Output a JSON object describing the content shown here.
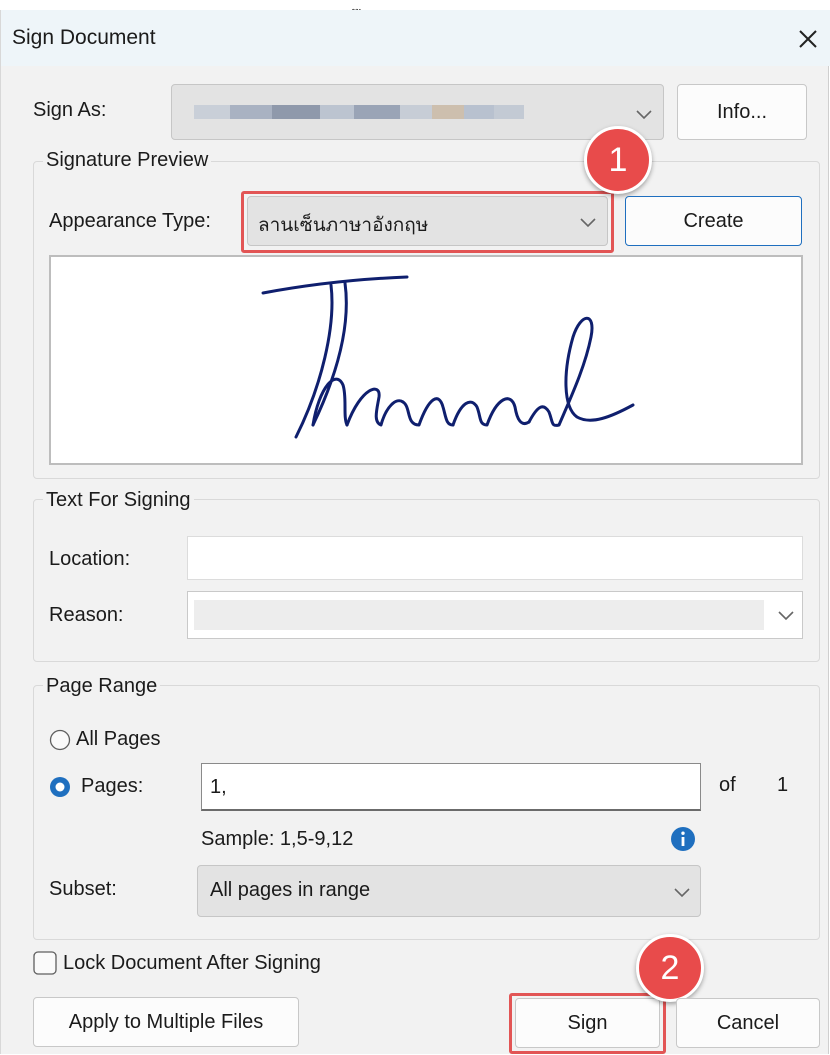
{
  "top_fragment": "ุ    ู",
  "dialog": {
    "title": "Sign Document",
    "close_icon": "close-icon"
  },
  "sign_as": {
    "label": "Sign As:",
    "value": "",
    "info_button": "Info..."
  },
  "signature_preview": {
    "legend": "Signature Preview",
    "appearance_label": "Appearance Type:",
    "appearance_value": "ลานเซ็นภาษาอังกฤษ",
    "create_button": "Create"
  },
  "text_for_signing": {
    "legend": "Text For Signing",
    "location_label": "Location:",
    "location_value": "",
    "reason_label": "Reason:",
    "reason_value": ""
  },
  "page_range": {
    "legend": "Page Range",
    "all_pages_label": "All Pages",
    "pages_label": "Pages:",
    "pages_value": "1,",
    "of_label": "of",
    "total_pages": "1",
    "sample_text": "Sample: 1,5-9,12",
    "info_icon": "info-icon",
    "subset_label": "Subset:",
    "subset_value": "All pages in range",
    "selected": "pages"
  },
  "lock_document": {
    "label": "Lock Document After Signing",
    "checked": false
  },
  "buttons": {
    "apply_multiple": "Apply to Multiple Files",
    "sign": "Sign",
    "cancel": "Cancel"
  },
  "annotations": {
    "step1": "1",
    "step2": "2",
    "highlight_color": "#e25555"
  },
  "colors": {
    "accent": "#1f6fbf",
    "dialog_bg": "#f2f2f2",
    "title_bg": "#eef5f9",
    "signature_ink": "#0f1f6e"
  }
}
